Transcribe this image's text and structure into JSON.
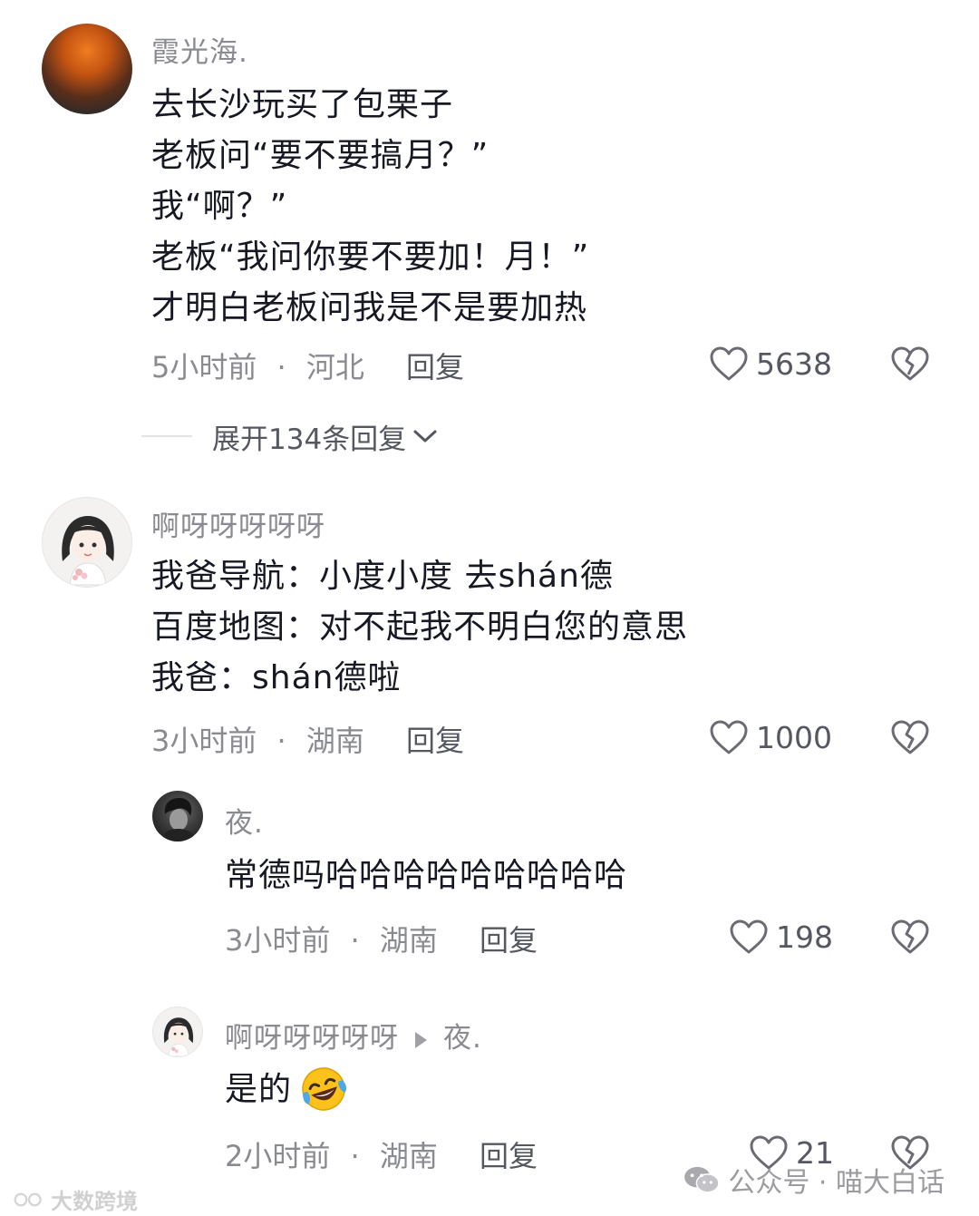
{
  "comments": [
    {
      "username": "霞光海.",
      "lines": [
        "去长沙玩买了包栗子",
        "老板问“要不要搞月？”",
        "我“啊？”",
        "老板“我问你要不要加！月！”",
        "才明白老板问我是不是要加热"
      ],
      "time": "5小时前",
      "location": "河北",
      "reply_label": "回复",
      "likes": "5638",
      "expand_label": "展开134条回复"
    },
    {
      "username": "啊呀呀呀呀呀",
      "lines": [
        "我爸导航：小度小度 去shán德",
        "百度地图：对不起我不明白您的意思",
        "我爸：shán德啦"
      ],
      "time": "3小时前",
      "location": "湖南",
      "reply_label": "回复",
      "likes": "1000"
    }
  ],
  "replies": [
    {
      "username": "夜.",
      "text": "常德吗哈哈哈哈哈哈哈哈哈",
      "time": "3小时前",
      "location": "湖南",
      "reply_label": "回复",
      "likes": "198"
    },
    {
      "username": "啊呀呀呀呀呀",
      "reply_to": "夜.",
      "text": "是的",
      "emoji": "laughing-crying-emoji",
      "time": "2小时前",
      "location": "湖南",
      "reply_label": "回复",
      "likes": "21"
    }
  ],
  "separator": "·",
  "watermarks": {
    "right": "公众号 · 喵大白话",
    "left": "大数跨境"
  },
  "colors": {
    "text": "#161823",
    "muted": "#8a8b91",
    "secondary": "#555761"
  },
  "icons": [
    "heart-outline-icon",
    "broken-heart-icon",
    "chevron-down-icon",
    "wechat-icon"
  ]
}
